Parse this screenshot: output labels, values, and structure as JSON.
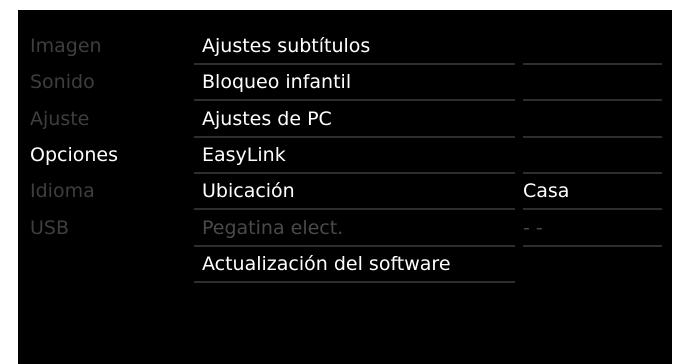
{
  "colors": {
    "background": "#000000",
    "text_active": "#ffffff",
    "text_dim": "#3e3e3e",
    "text_disabled": "#4a4a4a",
    "separator": "#2e2e2e"
  },
  "categories": [
    {
      "label": "Imagen",
      "state": "dim"
    },
    {
      "label": "Sonido",
      "state": "dim"
    },
    {
      "label": "Ajuste",
      "state": "dim"
    },
    {
      "label": "Opciones",
      "state": "selected"
    },
    {
      "label": "Idioma",
      "state": "dim"
    },
    {
      "label": "USB",
      "state": "dim"
    }
  ],
  "options": [
    {
      "label": "Ajustes subtítulos",
      "value": "",
      "enabled": true
    },
    {
      "label": "Bloqueo infantil",
      "value": "",
      "enabled": true
    },
    {
      "label": "Ajustes de PC",
      "value": "",
      "enabled": true
    },
    {
      "label": "EasyLink",
      "value": "",
      "enabled": true
    },
    {
      "label": "Ubicación",
      "value": "Casa",
      "enabled": true
    },
    {
      "label": "Pegatina elect.",
      "value": "- -",
      "enabled": false
    },
    {
      "label": "Actualización del software",
      "value": "",
      "enabled": true
    }
  ]
}
